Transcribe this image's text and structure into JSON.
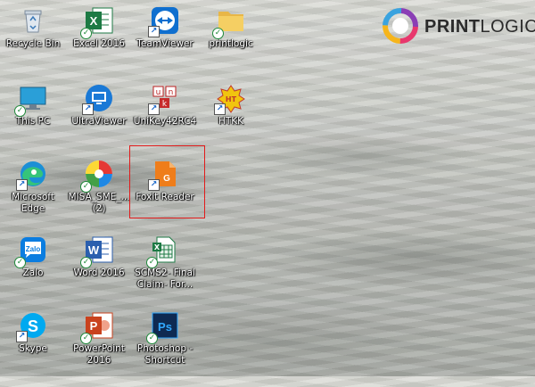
{
  "brand": {
    "name_part1": "PRINT",
    "name_part2": "LOGIC"
  },
  "icons": [
    {
      "label": "Recycle Bin",
      "icon": "recycle-bin-icon"
    },
    {
      "label": "Excel 2016",
      "icon": "excel-icon"
    },
    {
      "label": "TeamViewer",
      "icon": "teamviewer-icon"
    },
    {
      "label": "printlogic",
      "icon": "folder-icon"
    },
    {
      "label": "This PC",
      "icon": "this-pc-icon"
    },
    {
      "label": "UltraViewer",
      "icon": "ultraviewer-icon"
    },
    {
      "label": "UniKey42RC4",
      "icon": "unikey-icon"
    },
    {
      "label": "HTKK",
      "icon": "htkk-icon"
    },
    {
      "label": "Microsoft Edge",
      "icon": "edge-icon"
    },
    {
      "label": "MISA_SME_...\n(2)",
      "icon": "misa-icon"
    },
    {
      "label": "Foxit Reader",
      "icon": "foxit-reader-icon"
    },
    {
      "label": "Zalo",
      "icon": "zalo-icon"
    },
    {
      "label": "Word 2016",
      "icon": "word-icon"
    },
    {
      "label": "SCMS2- Final Claim- For...",
      "icon": "excel-file-icon"
    },
    {
      "label": "Skype",
      "icon": "skype-icon"
    },
    {
      "label": "PowerPoint 2016",
      "icon": "powerpoint-icon"
    },
    {
      "label": "Photoshop - Shortcut",
      "icon": "photoshop-icon"
    }
  ],
  "colors": {
    "highlight": "#e21b1b",
    "excel": "#1d7a44",
    "word": "#2b5fae",
    "powerpoint": "#c9421e",
    "photoshop": "#0e2a52",
    "foxit": "#ef7d1a",
    "teamviewer": "#0f6fcf"
  }
}
